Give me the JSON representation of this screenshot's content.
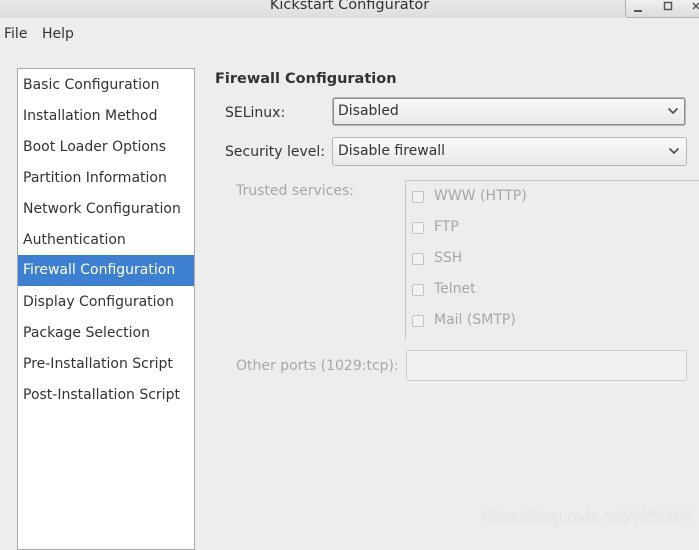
{
  "window": {
    "title": "Kickstart Configurator"
  },
  "menu": [
    {
      "label": "File"
    },
    {
      "label": "Help"
    }
  ],
  "sidebar": {
    "items": [
      {
        "label": "Basic Configuration"
      },
      {
        "label": "Installation Method"
      },
      {
        "label": "Boot Loader Options"
      },
      {
        "label": "Partition Information"
      },
      {
        "label": "Network Configuration"
      },
      {
        "label": "Authentication"
      },
      {
        "label": "Firewall Configuration",
        "selected": true
      },
      {
        "label": "Display Configuration"
      },
      {
        "label": "Package Selection"
      },
      {
        "label": "Pre-Installation Script"
      },
      {
        "label": "Post-Installation Script"
      }
    ]
  },
  "firewall": {
    "heading": "Firewall Configuration",
    "selinux": {
      "label": "SELinux:",
      "value": "Disabled"
    },
    "security_level": {
      "label": "Security level:",
      "value": "Disable firewall"
    },
    "trusted_services": {
      "label": "Trusted services:",
      "items": [
        {
          "label": "WWW (HTTP)",
          "checked": false
        },
        {
          "label": "FTP",
          "checked": false
        },
        {
          "label": "SSH",
          "checked": false
        },
        {
          "label": "Telnet",
          "checked": false
        },
        {
          "label": "Mail (SMTP)",
          "checked": false
        }
      ]
    },
    "other_ports": {
      "label": "Other ports (1029:tcp):",
      "value": ""
    }
  },
  "watermark": "https://blog.csdn.net/Y950904",
  "colors": {
    "selection": "#3d7fd1",
    "background": "#ededed"
  }
}
